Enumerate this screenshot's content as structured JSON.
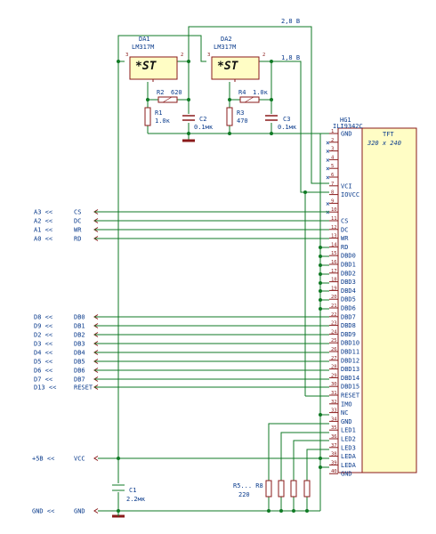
{
  "voltages": {
    "v28": "2,8 В",
    "v18": "1,8 В"
  },
  "da1": {
    "ref": "DA1",
    "value": "LM317M",
    "logo": "*ST",
    "pin_l": "3",
    "pin_r": "2"
  },
  "da2": {
    "ref": "DA2",
    "value": "LM317M",
    "logo": "*ST",
    "pin_l": "3",
    "pin_r": "2"
  },
  "r2": {
    "ref": "R2",
    "value": "620"
  },
  "r1": {
    "ref": "R1",
    "value": "1.0к"
  },
  "c2": {
    "ref": "C2",
    "value": "0.1мк"
  },
  "r4": {
    "ref": "R4",
    "value": "1.0к"
  },
  "r3": {
    "ref": "R3",
    "value": "470"
  },
  "c3": {
    "ref": "C3",
    "value": "0.1мк"
  },
  "c1": {
    "ref": "C1",
    "value": "2.2мк"
  },
  "rpack": {
    "ref": "R5... R8",
    "value": "220"
  },
  "display": {
    "ref": "HG1",
    "chip": "ILI9342C",
    "type": "TFT",
    "res": "320 x 240",
    "pins": [
      {
        "num": "1",
        "name": "GND"
      },
      {
        "num": "2",
        "name": ""
      },
      {
        "num": "3",
        "name": ""
      },
      {
        "num": "4",
        "name": ""
      },
      {
        "num": "5",
        "name": ""
      },
      {
        "num": "6",
        "name": ""
      },
      {
        "num": "7",
        "name": "VCI"
      },
      {
        "num": "8",
        "name": "IOVCC"
      },
      {
        "num": "9",
        "name": ""
      },
      {
        "num": "10",
        "name": ""
      },
      {
        "num": "11",
        "name": "CS"
      },
      {
        "num": "12",
        "name": "DC"
      },
      {
        "num": "13",
        "name": "WR"
      },
      {
        "num": "14",
        "name": "RD"
      },
      {
        "num": "15",
        "name": "DBD0"
      },
      {
        "num": "16",
        "name": "DBD1"
      },
      {
        "num": "17",
        "name": "DBD2"
      },
      {
        "num": "18",
        "name": "DBD3"
      },
      {
        "num": "19",
        "name": "DBD4"
      },
      {
        "num": "20",
        "name": "DBD5"
      },
      {
        "num": "21",
        "name": "DBD6"
      },
      {
        "num": "22",
        "name": "DBD7"
      },
      {
        "num": "23",
        "name": "DBD8"
      },
      {
        "num": "24",
        "name": "DBD9"
      },
      {
        "num": "25",
        "name": "DBD10"
      },
      {
        "num": "26",
        "name": "DBD11"
      },
      {
        "num": "27",
        "name": "DBD12"
      },
      {
        "num": "28",
        "name": "DBD13"
      },
      {
        "num": "29",
        "name": "DBD14"
      },
      {
        "num": "30",
        "name": "DBD15"
      },
      {
        "num": "31",
        "name": "RESET"
      },
      {
        "num": "32",
        "name": "IMO"
      },
      {
        "num": "33",
        "name": "NC"
      },
      {
        "num": "34",
        "name": "GND"
      },
      {
        "num": "35",
        "name": "LED1"
      },
      {
        "num": "36",
        "name": "LED2"
      },
      {
        "num": "37",
        "name": "LED3"
      },
      {
        "num": "38",
        "name": "LEDA"
      },
      {
        "num": "39",
        "name": "LEDA"
      },
      {
        "num": "40",
        "name": "GND"
      }
    ]
  },
  "inputs": [
    {
      "port": "A3 <<",
      "net": "CS"
    },
    {
      "port": "A2 <<",
      "net": "DC"
    },
    {
      "port": "A1 <<",
      "net": "WR"
    },
    {
      "port": "A0 <<",
      "net": "RD"
    },
    {
      "port": "D8 <<",
      "net": "DB0"
    },
    {
      "port": "D9 <<",
      "net": "DB1"
    },
    {
      "port": "D2 <<",
      "net": "DB2"
    },
    {
      "port": "D3 <<",
      "net": "DB3"
    },
    {
      "port": "D4 <<",
      "net": "DB4"
    },
    {
      "port": "D5 <<",
      "net": "DB5"
    },
    {
      "port": "D6 <<",
      "net": "DB6"
    },
    {
      "port": "D7 <<",
      "net": "DB7"
    },
    {
      "port": "D13 <<",
      "net": "RESET"
    }
  ],
  "power": [
    {
      "port": "+5В <<",
      "net": "VCC"
    },
    {
      "port": "GND <<",
      "net": "GND"
    }
  ]
}
